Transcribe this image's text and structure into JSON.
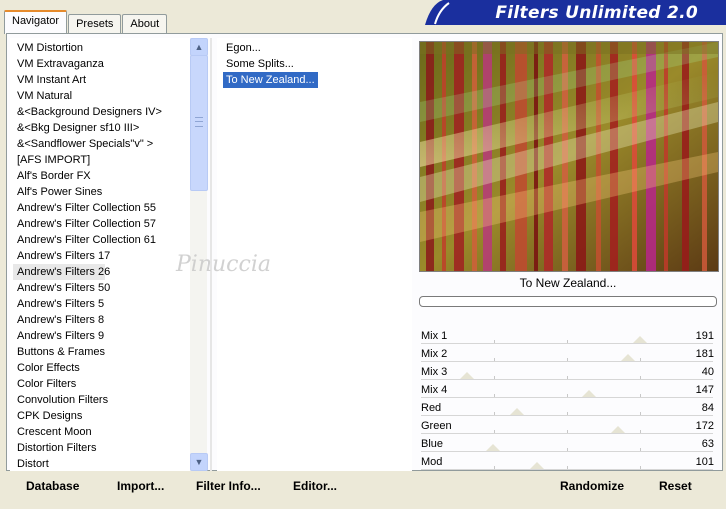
{
  "banner": {
    "title": "Filters Unlimited 2.0"
  },
  "tabs": [
    {
      "label": "Navigator",
      "active": true
    },
    {
      "label": "Presets",
      "active": false
    },
    {
      "label": "About",
      "active": false
    }
  ],
  "categories": [
    "VM Distortion",
    "VM Extravaganza",
    "VM Instant Art",
    "VM Natural",
    "&<Background Designers IV>",
    "&<Bkg Designer sf10 III>",
    "&<Sandflower Specials\"v\" >",
    "[AFS IMPORT]",
    "Alf's Border FX",
    "Alf's Power Sines",
    "Andrew's Filter Collection 55",
    "Andrew's Filter Collection 57",
    "Andrew's Filter Collection 61",
    "Andrew's Filters 17",
    "Andrew's Filters 26",
    "Andrew's Filters 50",
    "Andrew's Filters 5",
    "Andrew's Filters 8",
    "Andrew's Filters 9",
    "Buttons & Frames",
    "Color Effects",
    "Color Filters",
    "Convolution Filters",
    "CPK Designs",
    "Crescent Moon",
    "Distortion Filters",
    "Distort"
  ],
  "selected_category_index": 14,
  "filters": [
    "Egon...",
    "Some Splits...",
    "To New Zealand..."
  ],
  "selected_filter_index": 2,
  "filter_name": "To New Zealand...",
  "watermark": "Pinuccia",
  "params": [
    {
      "label": "Mix 1",
      "value": "191",
      "level": 0.749
    },
    {
      "label": "Mix 2",
      "value": "181",
      "level": 0.71
    },
    {
      "label": "Mix 3",
      "value": "40",
      "level": 0.157
    },
    {
      "label": "Mix 4",
      "value": "147",
      "level": 0.576
    },
    {
      "label": "Red",
      "value": "84",
      "level": 0.329
    },
    {
      "label": "Green",
      "value": "172",
      "level": 0.675
    },
    {
      "label": "Blue",
      "value": "63",
      "level": 0.247
    },
    {
      "label": "Mod",
      "value": "101",
      "level": 0.396
    }
  ],
  "buttons": {
    "database": "Database",
    "import": "Import...",
    "filter_info": "Filter Info...",
    "editor": "Editor...",
    "randomize": "Randomize",
    "reset": "Reset"
  },
  "scrollbar": {
    "up": "▲",
    "down": "▼"
  }
}
